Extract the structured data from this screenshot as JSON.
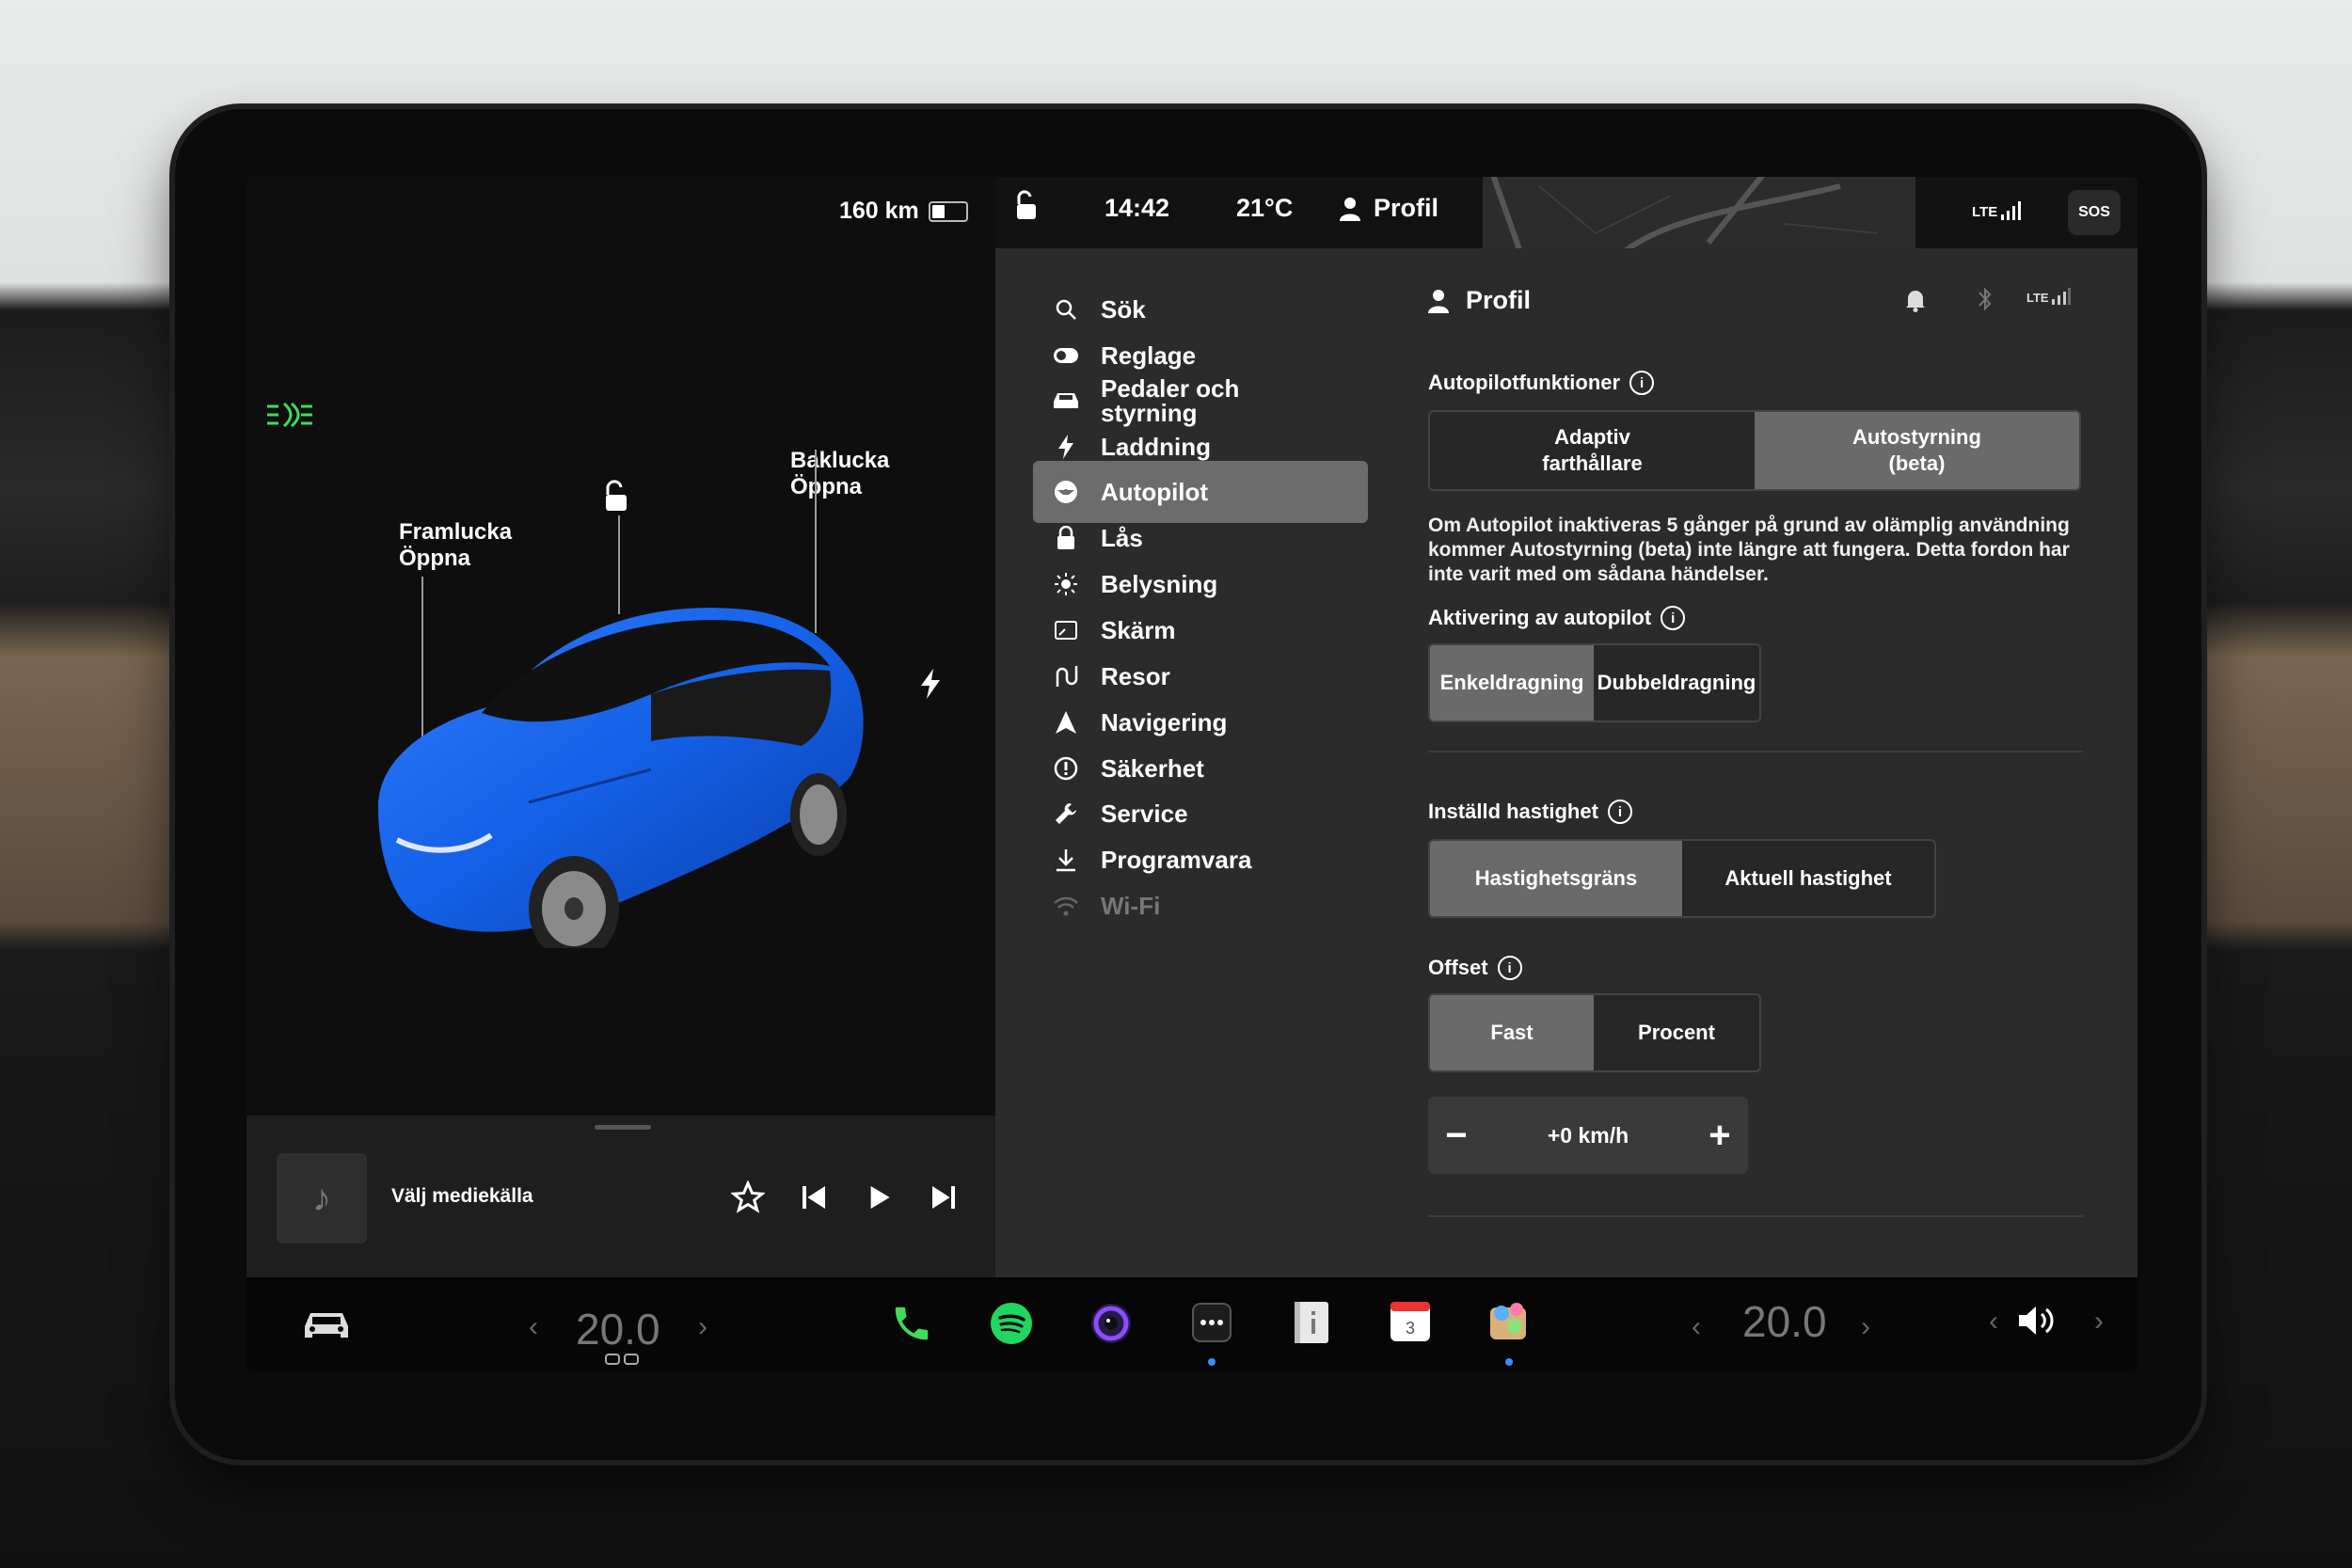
{
  "car_panel": {
    "range": "160 km",
    "battery_level_percent": 40,
    "front_trunk_label": "Framlucka",
    "front_trunk_action": "Öppna",
    "rear_trunk_label": "Baklucka",
    "rear_trunk_action": "Öppna"
  },
  "media": {
    "source_label": "Välj mediekälla"
  },
  "status_bar": {
    "time": "14:42",
    "temperature": "21°C",
    "profile": "Profil",
    "signal": "LTE",
    "sos": "SOS"
  },
  "menu": {
    "items": [
      {
        "label": "Sök",
        "icon": "search-icon"
      },
      {
        "label": "Reglage",
        "icon": "toggle-icon"
      },
      {
        "label": "Pedaler och\nstyrning",
        "icon": "car-icon"
      },
      {
        "label": "Laddning",
        "icon": "lightning-icon"
      },
      {
        "label": "Autopilot",
        "icon": "steering-wheel-icon"
      },
      {
        "label": "Lås",
        "icon": "lock-icon"
      },
      {
        "label": "Belysning",
        "icon": "sun-icon"
      },
      {
        "label": "Skärm",
        "icon": "screen-icon"
      },
      {
        "label": "Resor",
        "icon": "trips-icon"
      },
      {
        "label": "Navigering",
        "icon": "navigation-icon"
      },
      {
        "label": "Säkerhet",
        "icon": "safety-icon"
      },
      {
        "label": "Service",
        "icon": "wrench-icon"
      },
      {
        "label": "Programvara",
        "icon": "download-icon"
      },
      {
        "label": "Wi-Fi",
        "icon": "wifi-icon"
      }
    ],
    "active": "Autopilot"
  },
  "content": {
    "header": "Profil",
    "autopilot_features": {
      "title": "Autopilotfunktioner",
      "options": [
        "Adaptiv\nfarthållare",
        "Autostyrning\n(beta)"
      ],
      "selected": "Autostyrning\n(beta)",
      "description": "Om Autopilot inaktiveras 5 gånger på grund av olämplig användning kommer Autostyrning (beta) inte längre att fungera. Detta fordon har inte varit med om sådana händelser."
    },
    "activation": {
      "title": "Aktivering av autopilot",
      "options": [
        "Enkeldragning",
        "Dubbeldragning"
      ],
      "selected": "Enkeldragning"
    },
    "set_speed": {
      "title": "Inställd hastighet",
      "options": [
        "Hastighetsgräns",
        "Aktuell hastighet"
      ],
      "selected": "Hastighetsgräns"
    },
    "offset": {
      "title": "Offset",
      "options": [
        "Fast",
        "Procent"
      ],
      "selected": "Fast",
      "value": "+0 km/h"
    }
  },
  "dock": {
    "temp_left": "20.0",
    "temp_right": "20.0",
    "calendar_day": "3",
    "colors": {
      "phone": "#3fdc5a",
      "spotify": "#1ed760",
      "camera": "#8a4dff",
      "notify_dot": "#3b8cff"
    }
  }
}
